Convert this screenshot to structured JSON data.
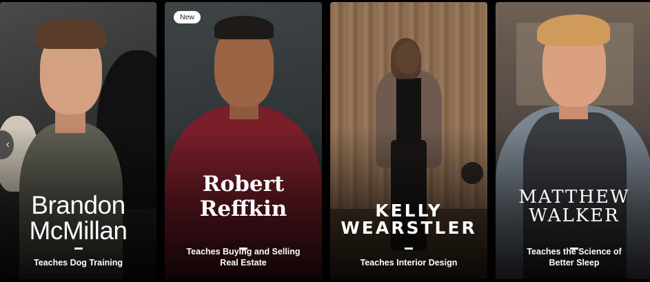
{
  "carousel": {
    "prev_icon": "‹",
    "cards": [
      {
        "name_line1": "Brandon",
        "name_line2": "McMillan",
        "badge": "",
        "subtitle_line1": "Teaches Dog Training",
        "subtitle_line2": ""
      },
      {
        "name_line1": "Robert",
        "name_line2": "Reffkin",
        "badge": "New",
        "subtitle_line1": "Teaches Buying and Selling",
        "subtitle_line2": "Real Estate"
      },
      {
        "name_line1": "KELLY",
        "name_line2": "WEARSTLER",
        "badge": "",
        "subtitle_line1": "Teaches Interior Design",
        "subtitle_line2": ""
      },
      {
        "name_line1": "MATTHEW",
        "name_line2": "WALKER",
        "badge": "",
        "subtitle_line1": "Teaches the Science of",
        "subtitle_line2": "Better Sleep"
      }
    ]
  }
}
